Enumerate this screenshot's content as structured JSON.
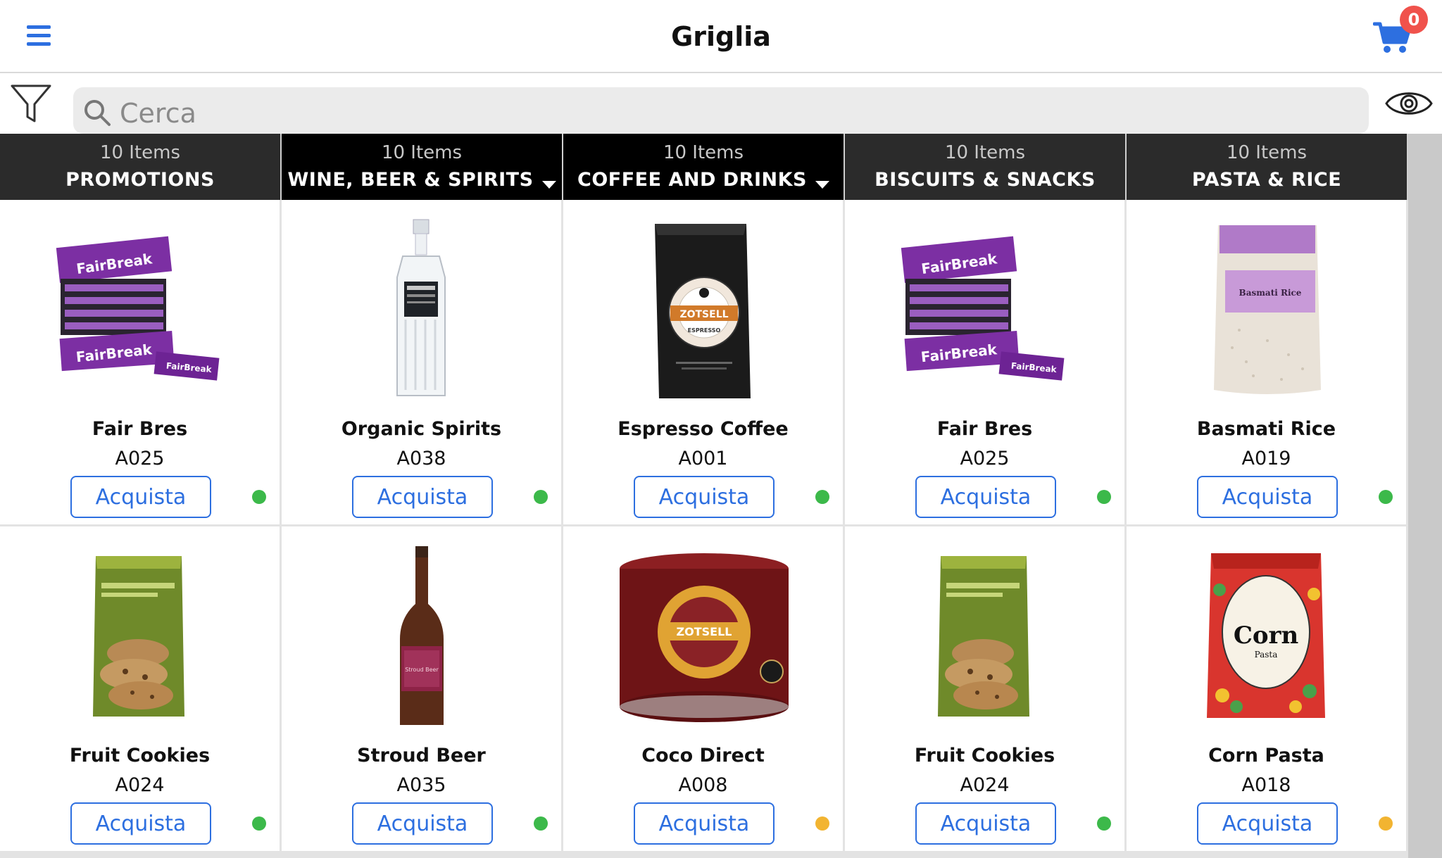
{
  "header": {
    "title": "Griglia",
    "cart_count": "0"
  },
  "search": {
    "placeholder": "Cerca"
  },
  "tabs": [
    {
      "count": "10 Items",
      "name": "PROMOTIONS",
      "has_caret": false
    },
    {
      "count": "10 Items",
      "name": "WINE, BEER & SPIRITS",
      "has_caret": true
    },
    {
      "count": "10 Items",
      "name": "COFFEE AND DRINKS",
      "has_caret": true
    },
    {
      "count": "10 Items",
      "name": "BISCUITS & SNACKS",
      "has_caret": false
    },
    {
      "count": "10 Items",
      "name": "PASTA & RICE",
      "has_caret": false
    }
  ],
  "products": [
    {
      "name": "Fair Bres",
      "code": "A025",
      "buy_label": "Acquista",
      "stock": "in-stock",
      "image": "fairbreak-box"
    },
    {
      "name": "Organic Spirits",
      "code": "A038",
      "buy_label": "Acquista",
      "stock": "in-stock",
      "image": "gin-bottle"
    },
    {
      "name": "Espresso Coffee",
      "code": "A001",
      "buy_label": "Acquista",
      "stock": "in-stock",
      "image": "coffee-bag"
    },
    {
      "name": "Fair Bres",
      "code": "A025",
      "buy_label": "Acquista",
      "stock": "in-stock",
      "image": "fairbreak-box"
    },
    {
      "name": "Basmati Rice",
      "code": "A019",
      "buy_label": "Acquista",
      "stock": "in-stock",
      "image": "rice-bag"
    },
    {
      "name": "Fruit Cookies",
      "code": "A024",
      "buy_label": "Acquista",
      "stock": "in-stock",
      "image": "cookie-bag"
    },
    {
      "name": "Stroud Beer",
      "code": "A035",
      "buy_label": "Acquista",
      "stock": "in-stock",
      "image": "beer-bottle"
    },
    {
      "name": "Coco Direct",
      "code": "A008",
      "buy_label": "Acquista",
      "stock": "low-stock",
      "image": "cocoa-tin"
    },
    {
      "name": "Fruit Cookies",
      "code": "A024",
      "buy_label": "Acquista",
      "stock": "in-stock",
      "image": "cookie-bag"
    },
    {
      "name": "Corn Pasta",
      "code": "A018",
      "buy_label": "Acquista",
      "stock": "low-stock",
      "image": "pasta-bag"
    }
  ],
  "image_text": {
    "fairbreak": "FairBreak",
    "fairbreak_small": "FairBreak",
    "zotsell": "ZOTSELL",
    "espresso": "ESPRESSO",
    "basmati": "Basmati Rice",
    "stroud": "Stroud Beer",
    "corn": "Corn",
    "corn_sub": "Pasta"
  },
  "colors": {
    "accent": "#2d6fe0",
    "badge": "#f0524c",
    "in_stock": "#3cb94a",
    "low_stock": "#f2b431"
  }
}
